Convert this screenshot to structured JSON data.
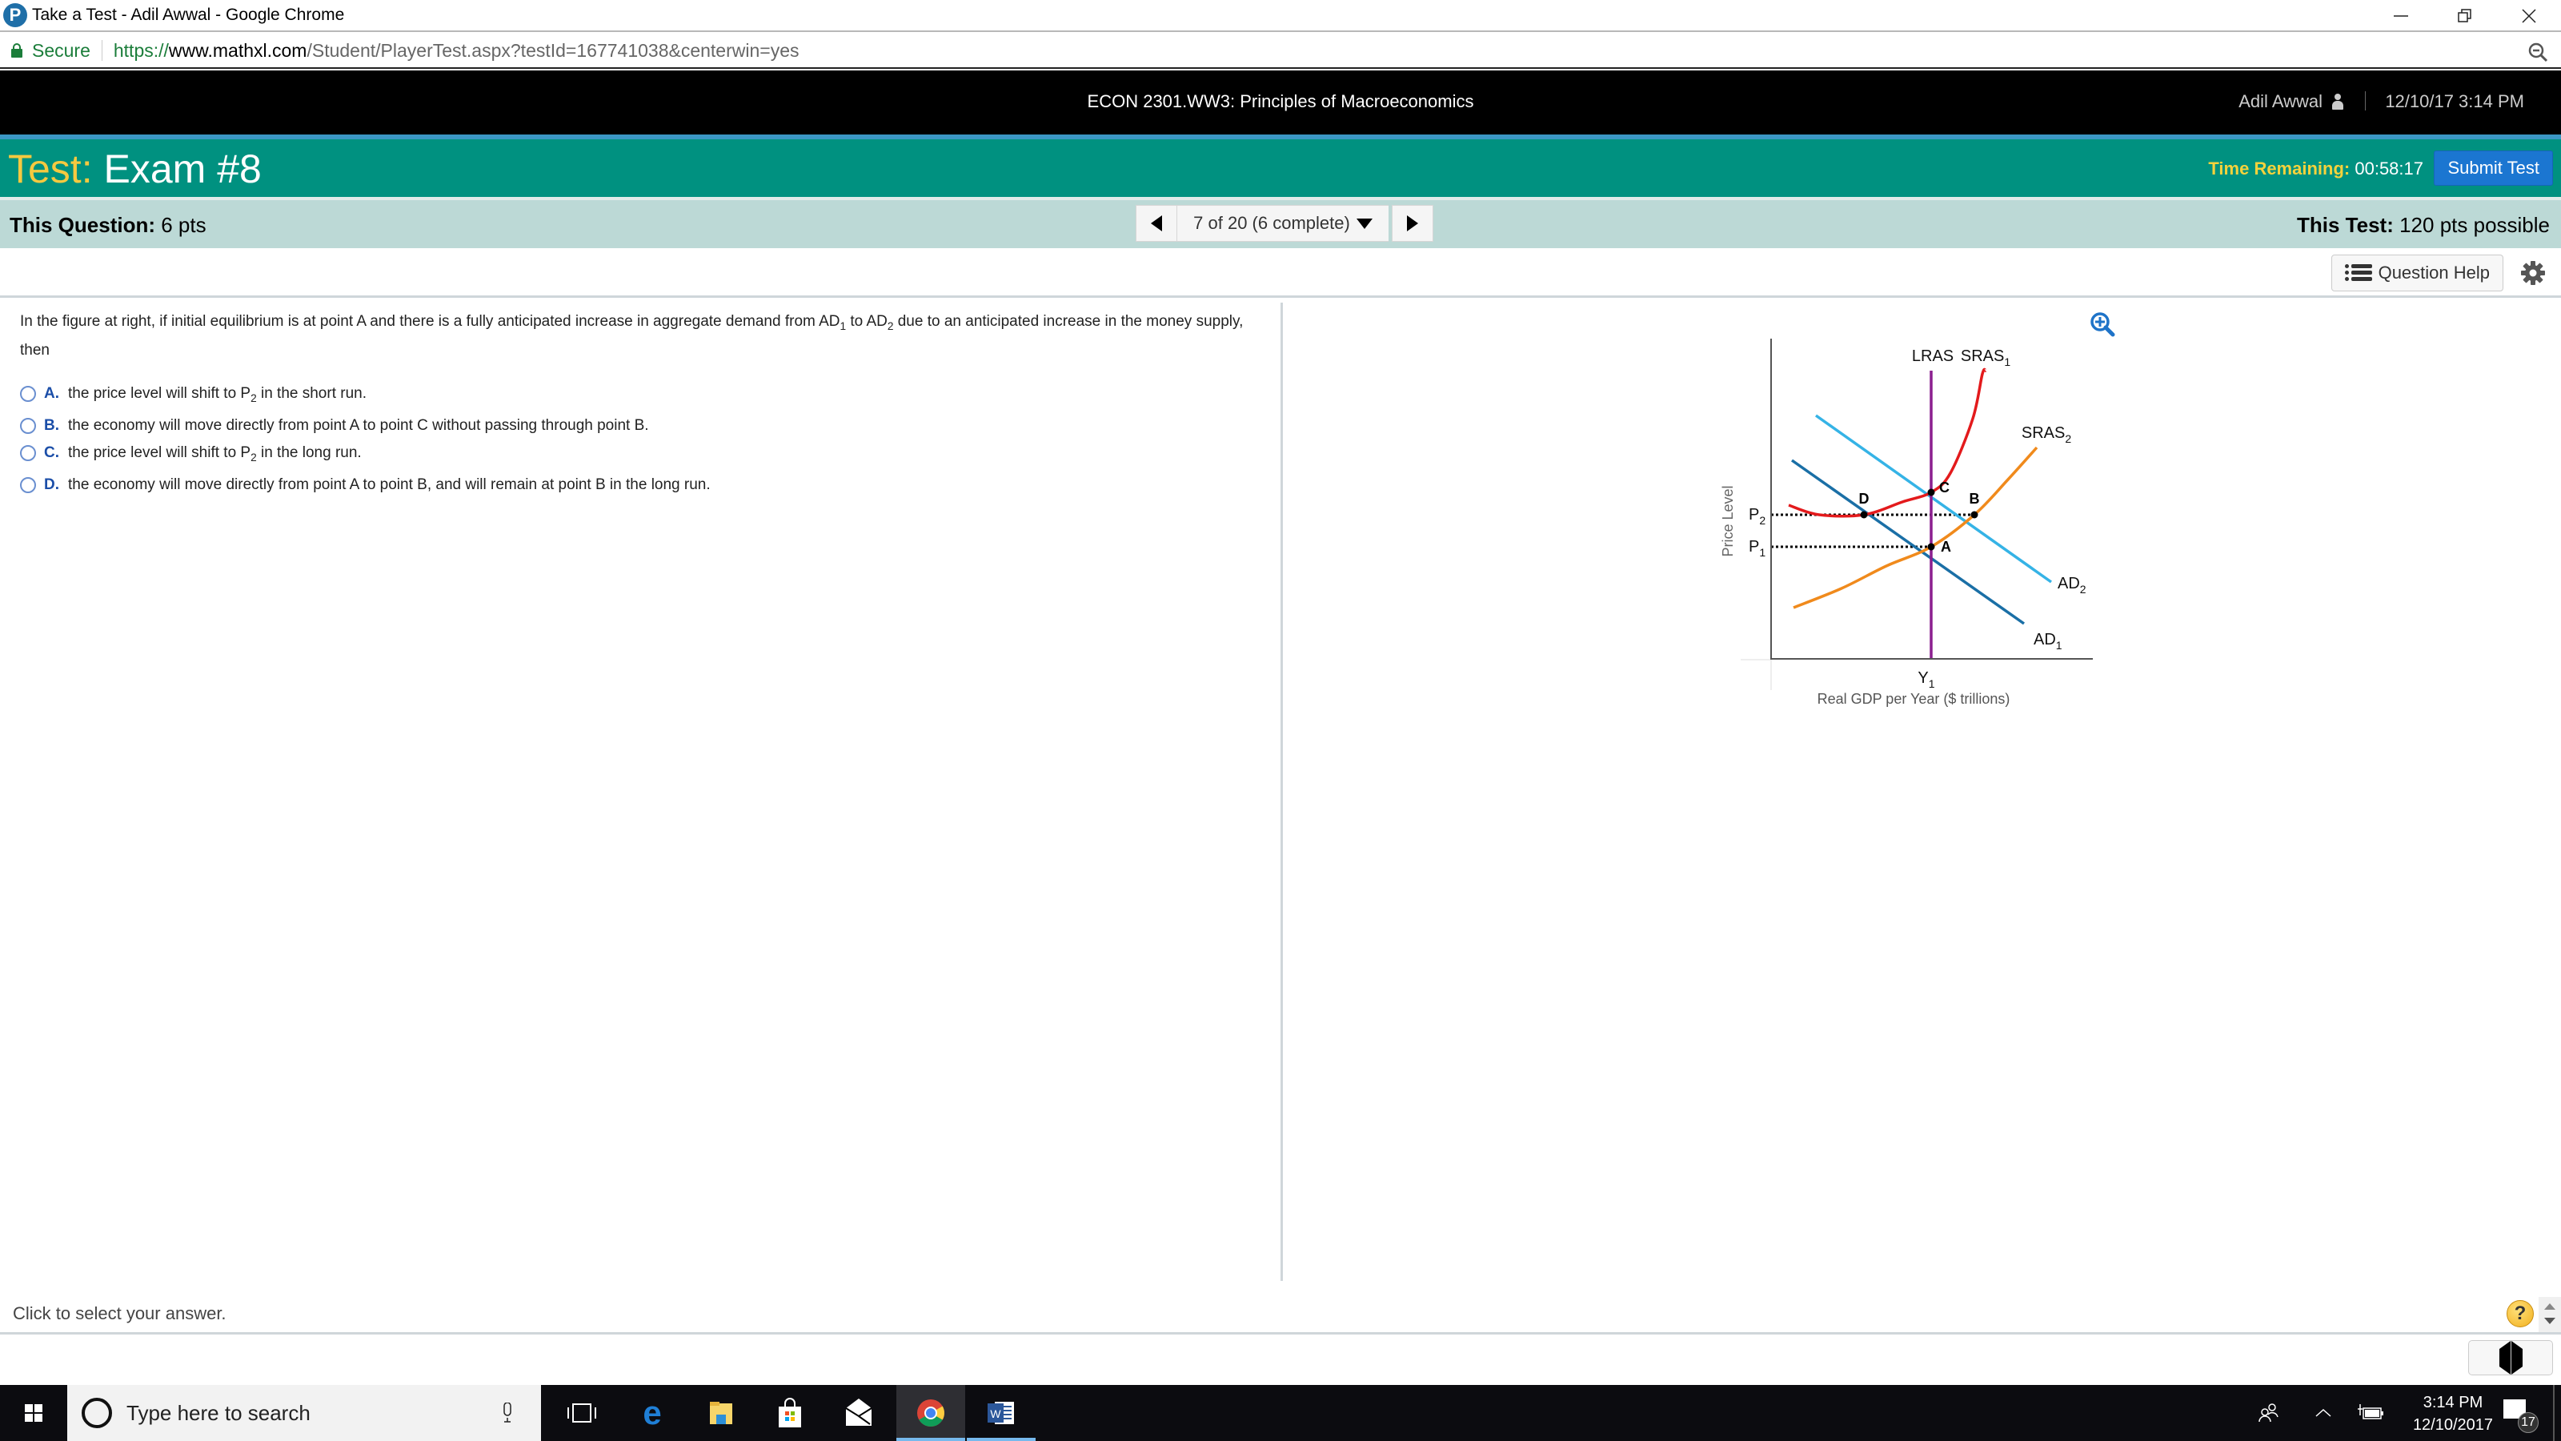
{
  "browser": {
    "window_title": "Take a Test - Adil Awwal - Google Chrome",
    "secure_label": "Secure",
    "url_scheme": "https://",
    "url_host": "www.mathxl.com",
    "url_path": "/Student/PlayerTest.aspx?testId=167741038&centerwin=yes",
    "window_controls": [
      "minimize-icon",
      "restore-icon",
      "close-icon"
    ]
  },
  "course_header": {
    "course_name": "ECON 2301.WW3: Principles of Macroeconomics",
    "user_name": "Adil Awwal",
    "datetime": "12/10/17 3:14 PM"
  },
  "test_header": {
    "label": "Test:",
    "name": "Exam #8",
    "time_remaining_label": "Time Remaining:",
    "time_remaining_value": "00:58:17",
    "submit_label": "Submit Test",
    "accent_color": "#009180",
    "label_color": "#f5c940"
  },
  "question_bar": {
    "this_question_label": "This Question:",
    "this_question_value": "6 pts",
    "navigator": "7 of 20 (6 complete)",
    "current_question": 7,
    "total_questions": 20,
    "completed": 6,
    "this_test_label": "This Test:",
    "this_test_value": "120 pts possible"
  },
  "tools": {
    "question_help_label": "Question Help"
  },
  "question": {
    "text_part1": "In the figure at right, if initial equilibrium is at point A and there is a fully anticipated increase in aggregate demand from  AD",
    "sub1": "1",
    "text_part2": " to AD",
    "sub2": "2",
    "text_part3": " due to an anticipated increase in the money supply, then",
    "choices": [
      {
        "letter": "A.",
        "pre": "the price level will shift to P",
        "sub": "2",
        "post": " in the short run."
      },
      {
        "letter": "B.",
        "pre": "the economy will move directly from point A to point C without passing through point B.",
        "sub": "",
        "post": ""
      },
      {
        "letter": "C.",
        "pre": "the price level will shift to P",
        "sub": "2",
        "post": " in the long run."
      },
      {
        "letter": "D.",
        "pre": "the economy will move directly from point A to point B, and will remain at point B in the long run.",
        "sub": "",
        "post": ""
      }
    ]
  },
  "chart_data": {
    "type": "line",
    "title": "",
    "xlabel": "Real GDP per Year ($ trillions)",
    "ylabel": "Price Level",
    "x_ticks": [
      {
        "label": "Y",
        "sub": "1",
        "x": 5
      }
    ],
    "y_ticks": [
      {
        "label": "P",
        "sub": "1",
        "y": 3.5
      },
      {
        "label": "P",
        "sub": "2",
        "y": 4.5
      }
    ],
    "xlim": [
      0,
      10
    ],
    "ylim": [
      0,
      10
    ],
    "grid": false,
    "series": [
      {
        "name": "LRAS",
        "label": "LRAS",
        "sub": "",
        "color": "#8b1f8f",
        "points": [
          [
            5,
            0
          ],
          [
            5,
            9.0
          ]
        ]
      },
      {
        "name": "SRAS1",
        "label": "SRAS",
        "sub": "1",
        "color": "#e31a1c",
        "points": [
          [
            0.55,
            4.8
          ],
          [
            1.5,
            4.5
          ],
          [
            2.9,
            4.5
          ],
          [
            4.1,
            4.9
          ],
          [
            5.0,
            5.2
          ],
          [
            5.6,
            5.8
          ],
          [
            6.3,
            7.5
          ],
          [
            6.6,
            8.9
          ],
          [
            6.7,
            9.0
          ]
        ]
      },
      {
        "name": "SRAS2",
        "label": "SRAS",
        "sub": "2",
        "color": "#f08a1c",
        "points": [
          [
            0.7,
            1.6
          ],
          [
            2.2,
            2.2
          ],
          [
            3.6,
            2.9
          ],
          [
            5.0,
            3.5
          ],
          [
            6.35,
            4.5
          ],
          [
            7.4,
            5.6
          ],
          [
            8.3,
            6.6
          ]
        ]
      },
      {
        "name": "AD1",
        "label": "AD",
        "sub": "1",
        "color": "#1a6fa6",
        "points": [
          [
            0.65,
            6.2
          ],
          [
            7.9,
            1.1
          ]
        ]
      },
      {
        "name": "AD2",
        "label": "AD",
        "sub": "2",
        "color": "#35b3e6",
        "points": [
          [
            1.4,
            7.6
          ],
          [
            8.75,
            2.4
          ]
        ]
      }
    ],
    "points": [
      {
        "label": "A",
        "x": 5.0,
        "y": 3.5
      },
      {
        "label": "B",
        "x": 6.35,
        "y": 4.5
      },
      {
        "label": "C",
        "x": 5.0,
        "y": 5.2
      },
      {
        "label": "D",
        "x": 2.9,
        "y": 4.5
      }
    ],
    "guides": [
      {
        "from": [
          0,
          4.5
        ],
        "to": [
          6.35,
          4.5
        ],
        "style": "dotted"
      },
      {
        "from": [
          0,
          3.5
        ],
        "to": [
          5.0,
          3.5
        ],
        "style": "dotted"
      }
    ]
  },
  "footer": {
    "instruction": "Click to select your answer."
  },
  "taskbar": {
    "search_placeholder": "Type here to search",
    "apps": [
      "task-view-icon",
      "edge-icon",
      "file-explorer-icon",
      "store-icon",
      "mail-icon",
      "chrome-icon",
      "word-icon"
    ],
    "active_app": "chrome-icon",
    "time": "3:14 PM",
    "date": "12/10/2017",
    "notification_count": "17"
  }
}
